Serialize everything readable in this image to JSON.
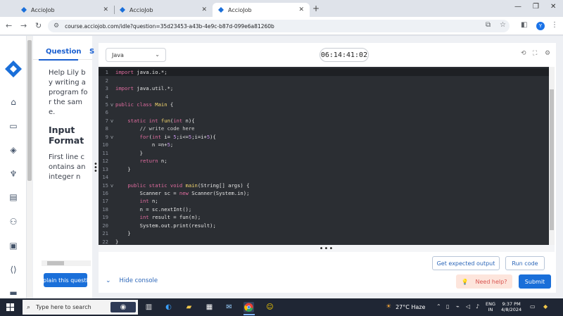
{
  "browser": {
    "tabs": [
      {
        "title": "AccioJob",
        "active": false
      },
      {
        "title": "AccioJob",
        "active": false
      },
      {
        "title": "AccioJob",
        "active": true
      }
    ],
    "url": "course.acciojob.com/idle?question=35d23453-a43b-4e9c-b87d-099e6a81260b",
    "profile_initial": "Y"
  },
  "question": {
    "tab_label": "Question",
    "tab_label_next": "S",
    "intro_text": "Help Lily by writing a program for the same.",
    "input_heading": "Input Format",
    "input_text": "First line contains an integer n",
    "explain_button": "Explain this question"
  },
  "editor": {
    "language": "Java",
    "timer": "06:14:41:02",
    "lines": [
      {
        "n": "1",
        "fold": "",
        "current": true,
        "tokens": [
          [
            "kw",
            "import "
          ],
          [
            "plain",
            "java.io.*;"
          ]
        ]
      },
      {
        "n": "2",
        "fold": "",
        "tokens": []
      },
      {
        "n": "3",
        "fold": "",
        "tokens": [
          [
            "kw",
            "import "
          ],
          [
            "plain",
            "java.util.*;"
          ]
        ]
      },
      {
        "n": "4",
        "fold": "",
        "tokens": []
      },
      {
        "n": "5",
        "fold": "v",
        "tokens": [
          [
            "kw",
            "public class "
          ],
          [
            "fn",
            "Main "
          ],
          [
            "plain",
            "{"
          ]
        ]
      },
      {
        "n": "6",
        "fold": "",
        "tokens": []
      },
      {
        "n": "7",
        "fold": "v",
        "tokens": [
          [
            "plain",
            "    "
          ],
          [
            "kw",
            "static int "
          ],
          [
            "fn",
            "fun"
          ],
          [
            "plain",
            "("
          ],
          [
            "kw",
            "int "
          ],
          [
            "plain",
            "n){"
          ]
        ]
      },
      {
        "n": "8",
        "fold": "",
        "tokens": [
          [
            "cmt",
            "        // write code here"
          ]
        ]
      },
      {
        "n": "9",
        "fold": "v",
        "tokens": [
          [
            "plain",
            "        "
          ],
          [
            "kw",
            "for"
          ],
          [
            "plain",
            "("
          ],
          [
            "kw",
            "int "
          ],
          [
            "plain",
            "i= "
          ],
          [
            "num",
            "5"
          ],
          [
            "plain",
            ";i<="
          ],
          [
            "num",
            "5"
          ],
          [
            "plain",
            ";i=i+"
          ],
          [
            "num",
            "5"
          ],
          [
            "plain",
            ")"
          ],
          [
            "plain",
            "{"
          ]
        ]
      },
      {
        "n": "10",
        "fold": "",
        "tokens": [
          [
            "plain",
            "            n =n+"
          ],
          [
            "num",
            "5"
          ],
          [
            "plain",
            ";"
          ]
        ]
      },
      {
        "n": "11",
        "fold": "",
        "tokens": [
          [
            "plain",
            "        }"
          ]
        ]
      },
      {
        "n": "12",
        "fold": "",
        "tokens": [
          [
            "plain",
            "        "
          ],
          [
            "kw",
            "return "
          ],
          [
            "plain",
            "n;"
          ]
        ]
      },
      {
        "n": "13",
        "fold": "",
        "tokens": [
          [
            "plain",
            "    }"
          ]
        ]
      },
      {
        "n": "14",
        "fold": "",
        "tokens": []
      },
      {
        "n": "15",
        "fold": "v",
        "tokens": [
          [
            "plain",
            "    "
          ],
          [
            "kw",
            "public static void "
          ],
          [
            "fn",
            "main"
          ],
          [
            "plain",
            "(String[] args) {"
          ]
        ]
      },
      {
        "n": "16",
        "fold": "",
        "tokens": [
          [
            "plain",
            "        Scanner sc = "
          ],
          [
            "kw",
            "new "
          ],
          [
            "plain",
            "Scanner(System.in);"
          ]
        ]
      },
      {
        "n": "17",
        "fold": "",
        "tokens": [
          [
            "plain",
            "        "
          ],
          [
            "kw",
            "int "
          ],
          [
            "plain",
            "n;"
          ]
        ]
      },
      {
        "n": "18",
        "fold": "",
        "tokens": [
          [
            "plain",
            "        n = sc.nextInt();"
          ]
        ]
      },
      {
        "n": "19",
        "fold": "",
        "tokens": [
          [
            "plain",
            "        "
          ],
          [
            "kw",
            "int "
          ],
          [
            "plain",
            "result = fun(n);"
          ]
        ]
      },
      {
        "n": "20",
        "fold": "",
        "tokens": [
          [
            "plain",
            "        System.out.print(result);"
          ]
        ]
      },
      {
        "n": "21",
        "fold": "",
        "tokens": [
          [
            "plain",
            "    }"
          ]
        ]
      },
      {
        "n": "22",
        "fold": "",
        "tokens": [
          [
            "plain",
            "}"
          ]
        ]
      }
    ],
    "get_expected_output": "Get expected output",
    "run_code": "Run code",
    "hide_console": "Hide console",
    "need_help": "Need help?",
    "submit": "Submit"
  },
  "taskbar": {
    "search_placeholder": "Type here to search",
    "weather": "27°C  Haze",
    "lang_line1": "ENG",
    "lang_line2": "IN",
    "time": "9:37 PM",
    "date": "4/8/2024"
  },
  "colors": {
    "accent": "#1a6fd9",
    "editor_bg": "#2b2e33",
    "keyword": "#e06c9f",
    "function": "#f5d76e"
  }
}
